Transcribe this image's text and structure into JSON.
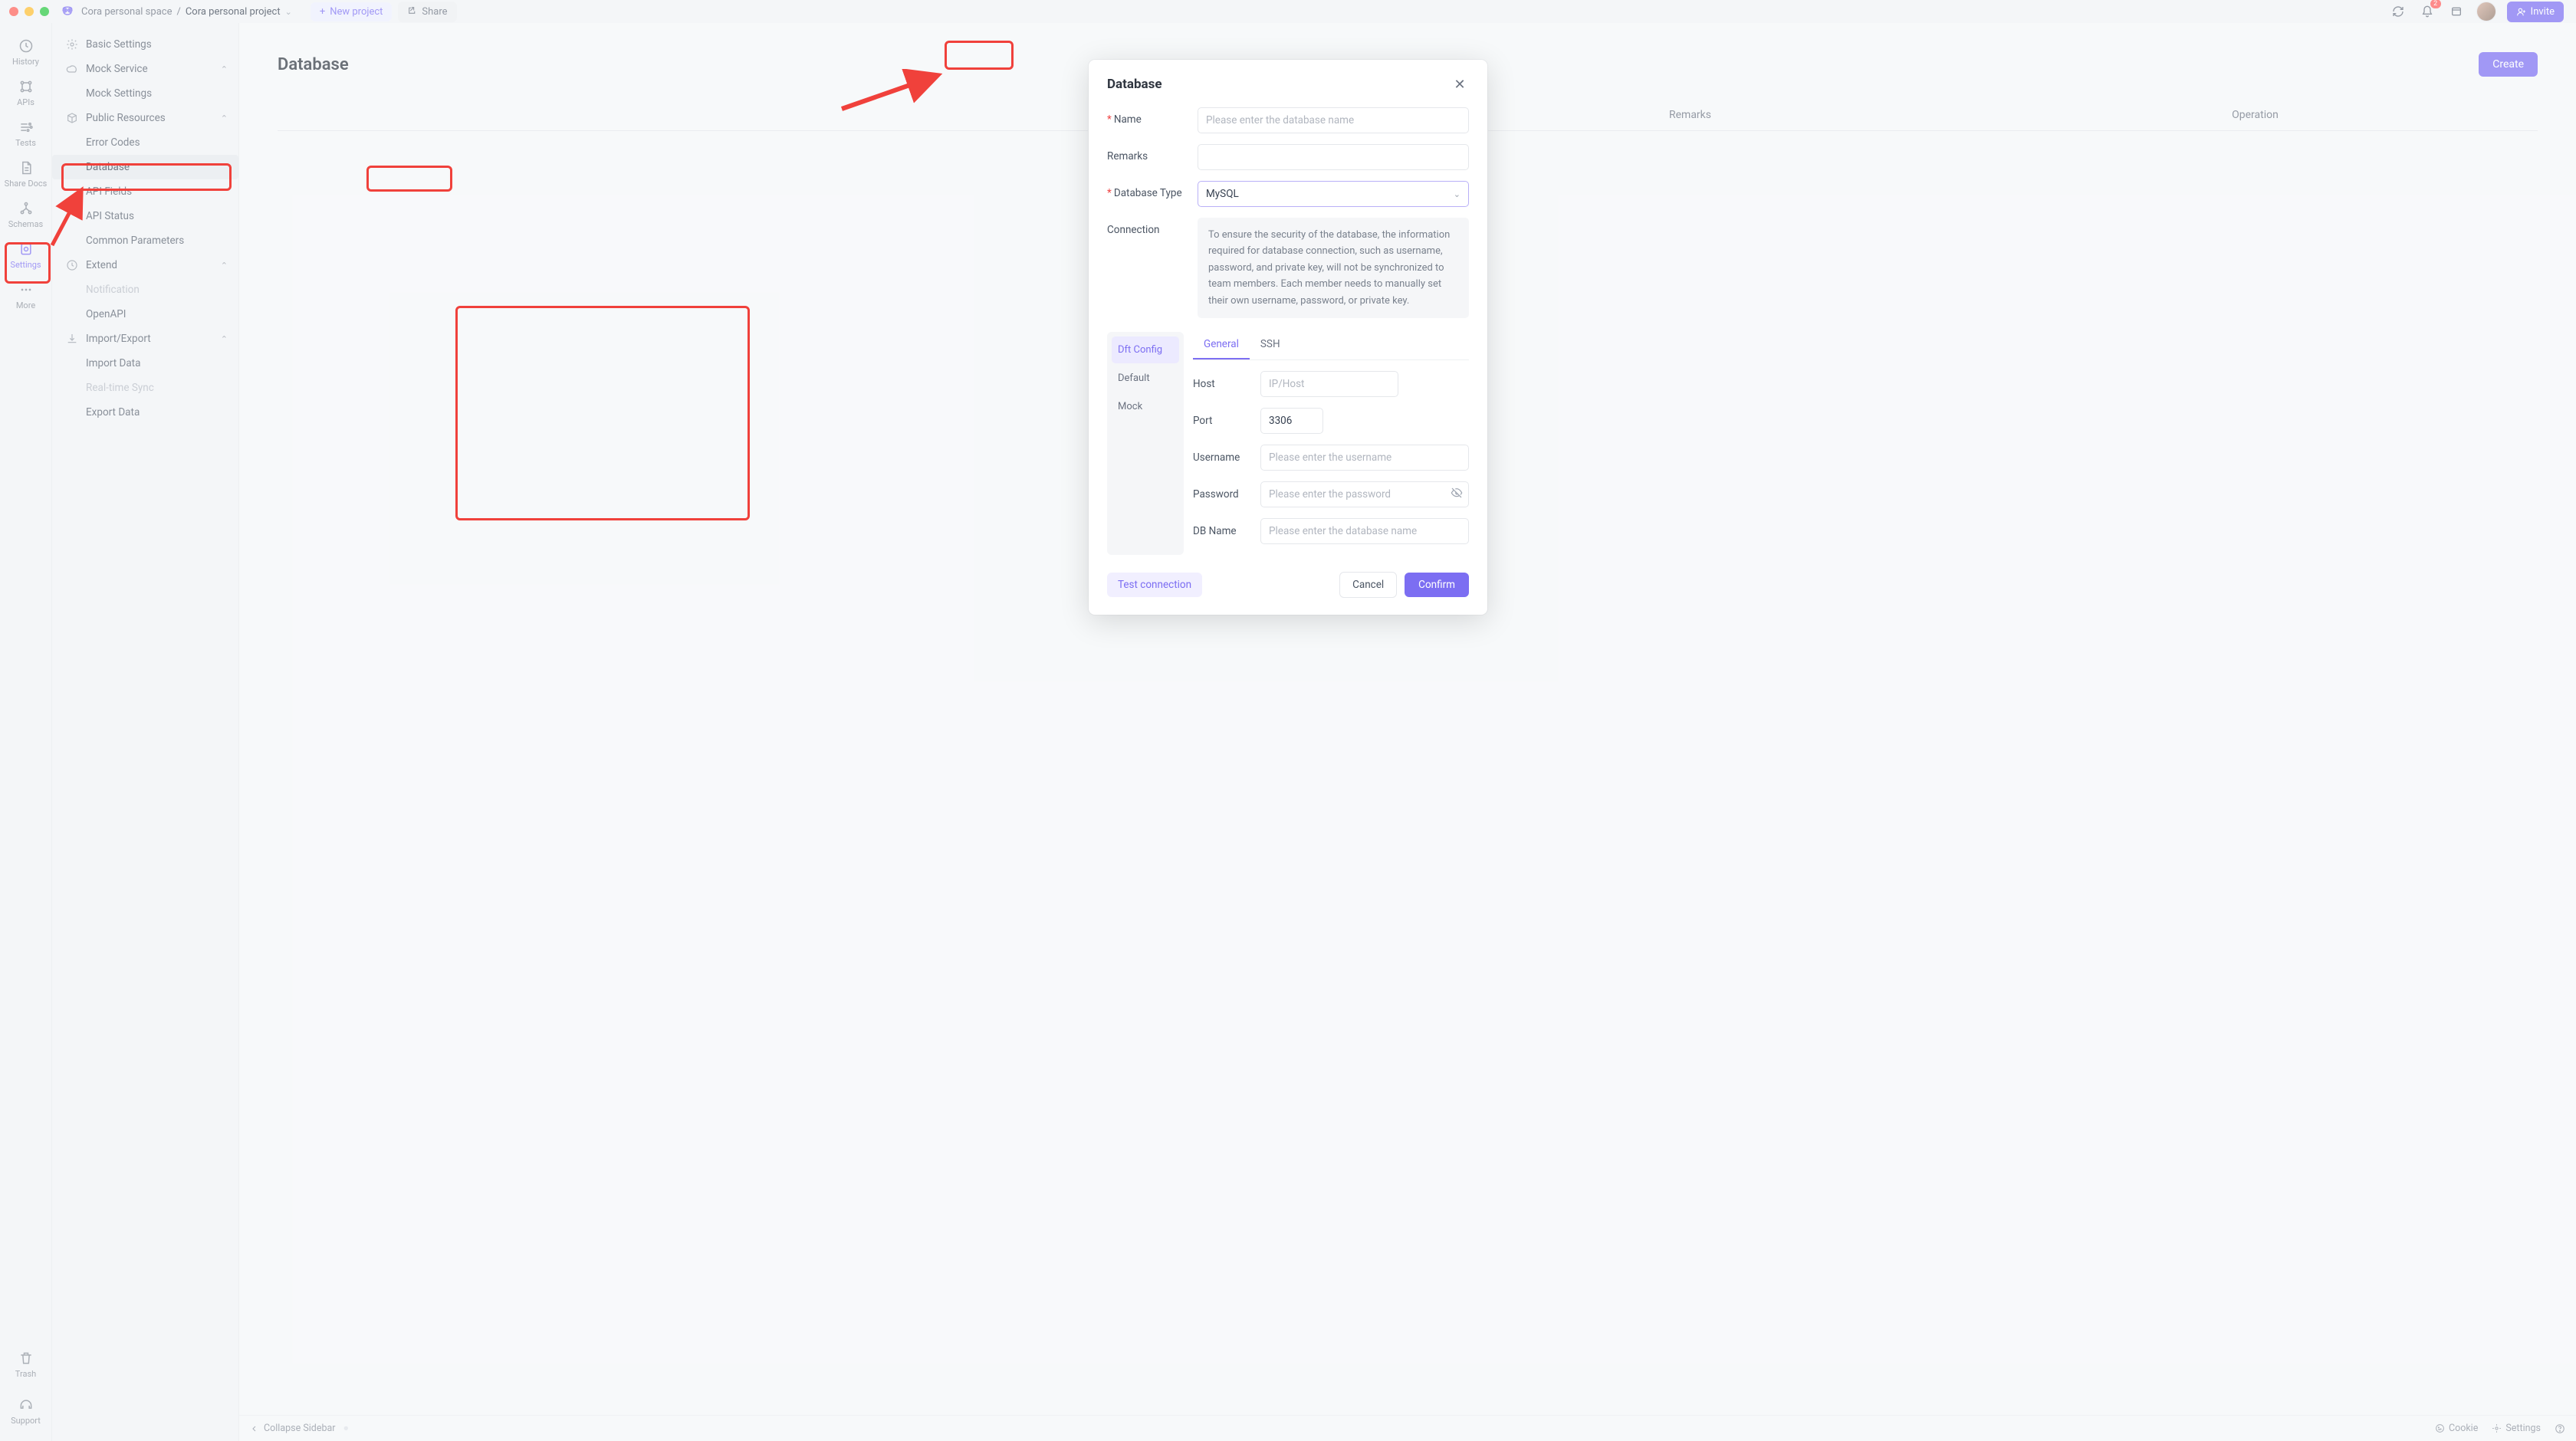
{
  "breadcrumbs": {
    "space": "Cora personal space",
    "project": "Cora personal project"
  },
  "titlebar": {
    "new_project": "New project",
    "share": "Share",
    "notif_count": "2",
    "invite": "Invite"
  },
  "rail": {
    "history": "History",
    "apis": "APIs",
    "tests": "Tests",
    "share_docs": "Share Docs",
    "schemas": "Schemas",
    "settings": "Settings",
    "more": "More",
    "trash": "Trash",
    "support": "Support"
  },
  "sidenav": {
    "basic_settings": "Basic Settings",
    "mock_service": "Mock Service",
    "mock_settings": "Mock Settings",
    "public_resources": "Public Resources",
    "error_codes": "Error Codes",
    "database": "Database",
    "api_fields": "API Fields",
    "api_status": "API Status",
    "common_parameters": "Common Parameters",
    "extend": "Extend",
    "notification": "Notification",
    "openapi": "OpenAPI",
    "import_export": "Import/Export",
    "import_data": "Import Data",
    "real_time_sync": "Real-time Sync",
    "export_data": "Export Data"
  },
  "main": {
    "title": "Database",
    "create_btn": "Create",
    "col_remarks": "Remarks",
    "col_operation": "Operation"
  },
  "footer": {
    "collapse": "Collapse Sidebar",
    "cookie": "Cookie",
    "settings": "Settings"
  },
  "modal": {
    "title": "Database",
    "name_label": "Name",
    "name_placeholder": "Please enter the database name",
    "remarks_label": "Remarks",
    "dbtype_label": "Database Type",
    "dbtype_value": "MySQL",
    "connection_label": "Connection",
    "connection_note": "To ensure the security of the database, the information required for database connection, such as username, password, and private key, will not be synchronized to team members. Each member needs to manually set their own username, password, or private key.",
    "cfg_tab_dft": "Dft Config",
    "cfg_tab_default": "Default",
    "cfg_tab_mock": "Mock",
    "sub_general": "General",
    "sub_ssh": "SSH",
    "host_label": "Host",
    "host_placeholder": "IP/Host",
    "port_label": "Port",
    "port_value": "3306",
    "username_label": "Username",
    "username_placeholder": "Please enter the username",
    "password_label": "Password",
    "password_placeholder": "Please enter the password",
    "dbname_label": "DB Name",
    "dbname_placeholder": "Please enter the database name",
    "test_conn": "Test connection",
    "cancel": "Cancel",
    "confirm": "Confirm"
  }
}
